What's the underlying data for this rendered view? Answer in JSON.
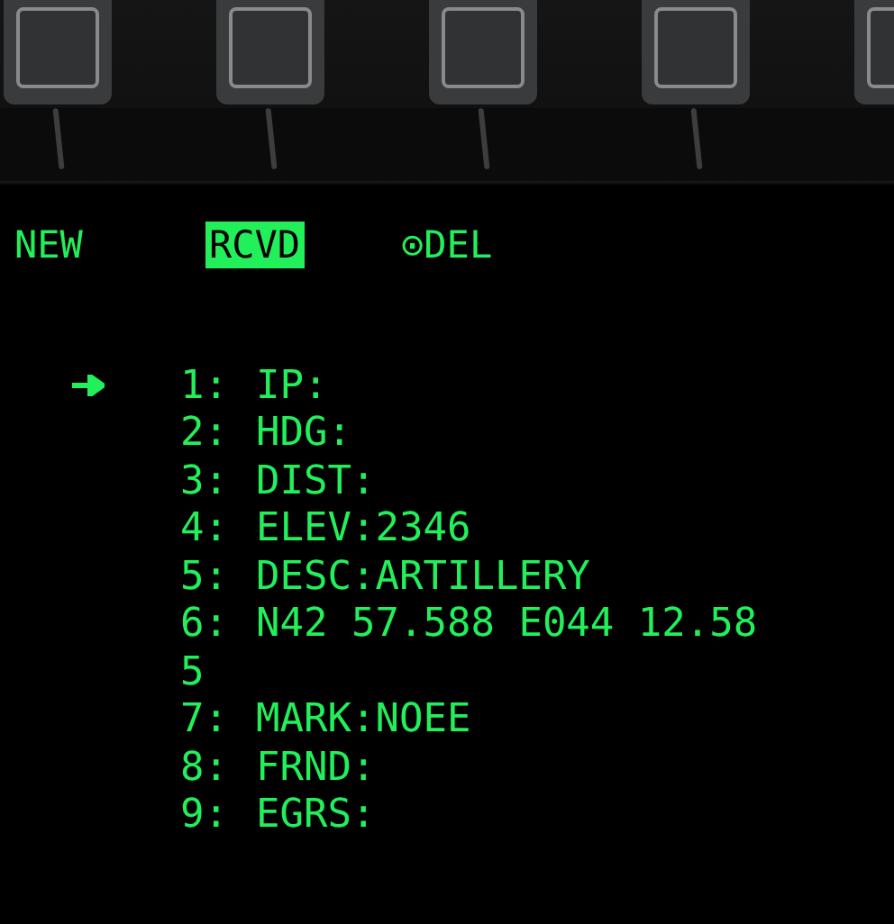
{
  "menu": [
    {
      "label": "NEW",
      "selected": false
    },
    {
      "label": "RCVD",
      "selected": true
    },
    {
      "label": "⊙DEL",
      "selected": false
    }
  ],
  "lines": [
    {
      "kind": "field",
      "number": "1:",
      "text": "IP:",
      "selected": true
    },
    {
      "kind": "field",
      "number": "2:",
      "text": "HDG:",
      "selected": false
    },
    {
      "kind": "field",
      "number": "3:",
      "text": "DIST:",
      "selected": false
    },
    {
      "kind": "field",
      "number": "4:",
      "text": "ELEV:2346",
      "selected": false
    },
    {
      "kind": "field",
      "number": "5:",
      "text": "DESC:ARTILLERY",
      "selected": false
    },
    {
      "kind": "field",
      "number": "6:",
      "text": "N42 57.588 E044 12.58",
      "selected": false
    },
    {
      "kind": "continuation",
      "text": "5",
      "selected": false
    },
    {
      "kind": "field",
      "number": "7:",
      "text": "MARK:NOEE",
      "selected": false
    },
    {
      "kind": "field",
      "number": "8:",
      "text": "FRND:",
      "selected": false
    },
    {
      "kind": "field",
      "number": "9:",
      "text": "EGRS:",
      "selected": false
    }
  ]
}
